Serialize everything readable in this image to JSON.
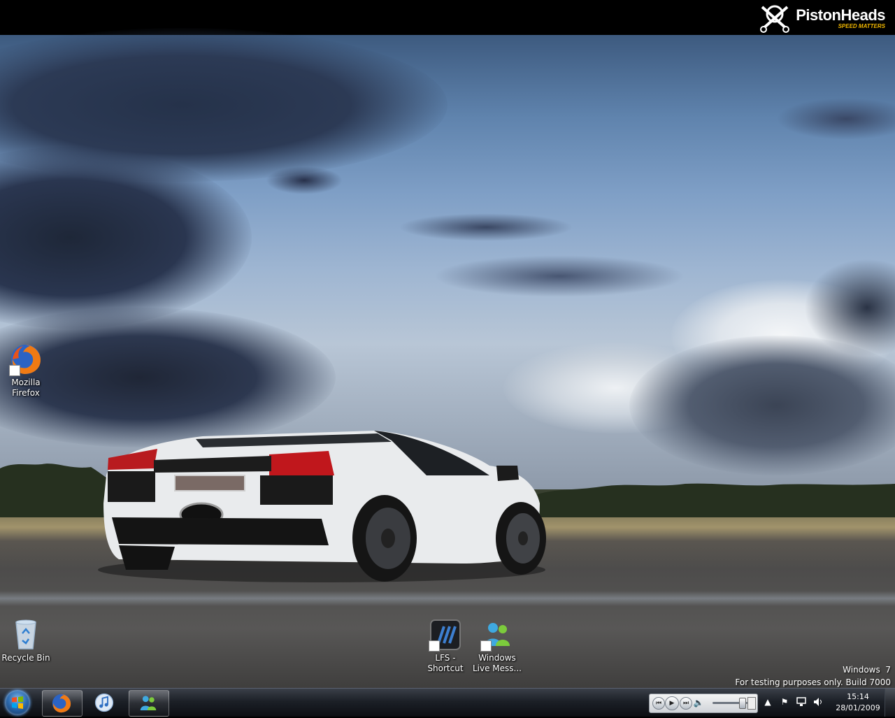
{
  "branding": {
    "name": "PistonHeads",
    "tagline": "SPEED MATTERS"
  },
  "desktop": {
    "icons": [
      {
        "label_line1": "Mozilla",
        "label_line2": "Firefox",
        "icon": "firefox-icon"
      },
      {
        "label_line1": "Recycle Bin",
        "label_line2": "",
        "icon": "recycle-bin-icon"
      },
      {
        "label_line1": "LFS -",
        "label_line2": "Shortcut",
        "icon": "lfs-icon"
      },
      {
        "label_line1": "Windows",
        "label_line2": "Live Mess...",
        "icon": "windows-live-messenger-icon"
      }
    ]
  },
  "watermark": {
    "line1": "Windows  7",
    "line2": "For testing purposes only. Build 7000"
  },
  "taskbar": {
    "start_icon": "windows-start-orb",
    "pinned": [
      {
        "icon": "firefox-icon",
        "active": true
      },
      {
        "icon": "itunes-icon",
        "active": false
      },
      {
        "icon": "windows-live-messenger-icon",
        "active": true
      }
    ],
    "media_player": {
      "buttons": [
        "previous-icon",
        "play-icon",
        "next-icon",
        "volume-icon",
        "restore-icon"
      ]
    },
    "tray": {
      "icons": [
        "show-hidden-icons-arrow",
        "action-center-flag-icon",
        "network-icon",
        "volume-icon"
      ]
    },
    "clock": {
      "time": "15:14",
      "date": "28/01/2009"
    }
  },
  "colors": {
    "taskbar": "#1c2027",
    "brand_accent": "#f2b800",
    "sky": "#7f9fc6"
  }
}
